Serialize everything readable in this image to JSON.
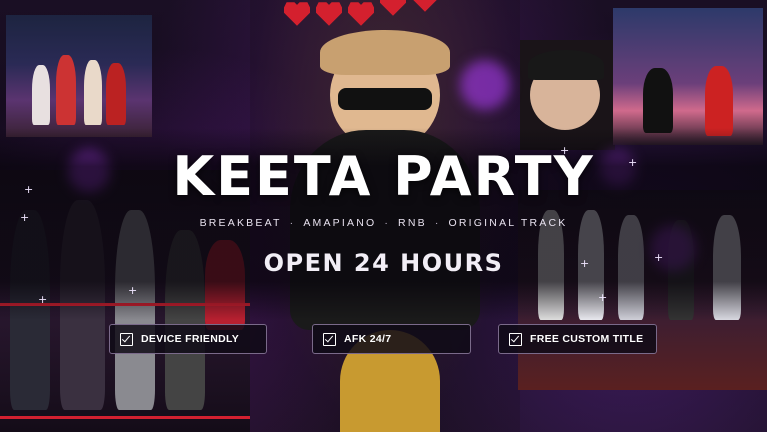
{
  "poster": {
    "title": "KEETA PARTY",
    "genres": [
      "BREAKBEAT",
      "AMAPIANO",
      "RNB",
      "ORIGINAL TRACK"
    ],
    "genre_separator": "·",
    "hours": "OPEN 24 HOURS",
    "features": [
      {
        "label": "DEVICE FRIENDLY",
        "icon": "checkbox-checked-icon"
      },
      {
        "label": "AFK 24/7",
        "icon": "checkbox-checked-icon"
      },
      {
        "label": "FREE CUSTOM TITLE",
        "icon": "checkbox-checked-icon"
      }
    ]
  },
  "decor": {
    "hearts": 5,
    "heart_color": "#d4202e",
    "accent_purple": "#9b3fe0",
    "accent_red": "#d42030"
  }
}
